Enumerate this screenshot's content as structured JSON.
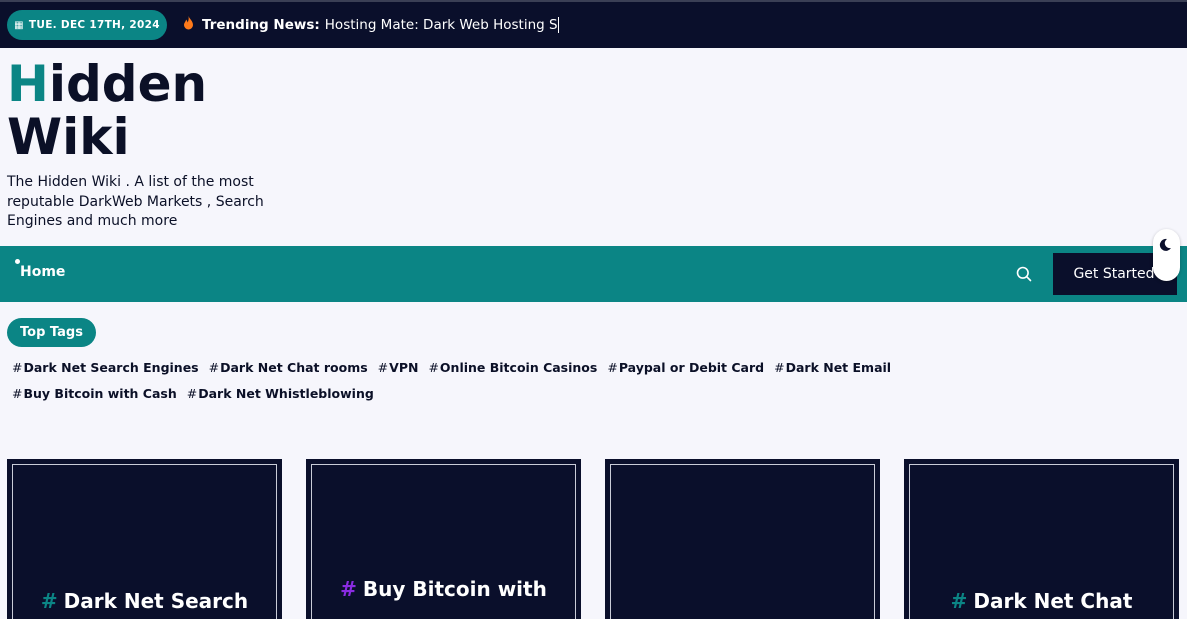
{
  "topbar": {
    "date": "TUE. DEC 17TH, 2024",
    "trending_label": "Trending News:",
    "trending_text": "Hosting Mate: Dark Web Hosting S"
  },
  "site": {
    "title_first": "H",
    "title_rest_line1": "idden",
    "title_line2": "Wiki",
    "tagline": "The Hidden Wiki . A list of the most reputable DarkWeb Markets , Search Engines and much more"
  },
  "nav": {
    "home": "Home",
    "cta": "Get Started"
  },
  "tags": {
    "heading": "Top Tags",
    "items": [
      "Dark Net Search Engines",
      "Dark Net Chat rooms",
      "VPN",
      "Online Bitcoin Casinos",
      "Paypal or Debit Card",
      "Dark Net Email",
      "Buy Bitcoin with Cash",
      "Dark Net Whistleblowing"
    ]
  },
  "cards": [
    {
      "title": "Dark Net Search",
      "hash_color": "#0b8585"
    },
    {
      "title": "Buy Bitcoin with",
      "hash_color": "#8a2be2"
    },
    {
      "title": "",
      "hash_color": ""
    },
    {
      "title": "Dark Net Chat",
      "hash_color": "#0b8585"
    }
  ],
  "colors": {
    "accent": "#0b8585",
    "dark": "#0a0f2b",
    "background": "#f6f6fc"
  }
}
